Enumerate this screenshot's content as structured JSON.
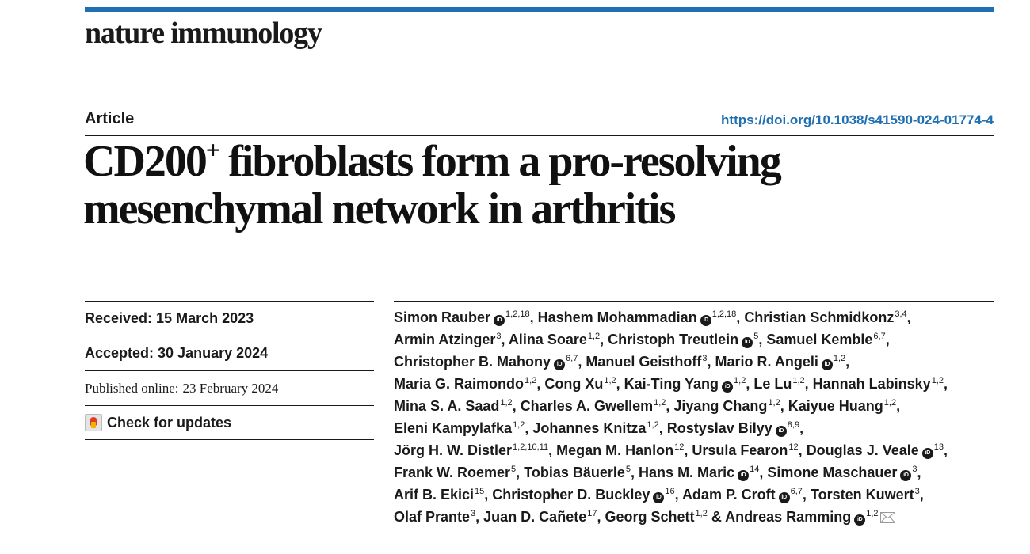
{
  "journal": "nature immunology",
  "article_type": "Article",
  "doi": "https://doi.org/10.1038/s41590-024-01774-4",
  "title": {
    "part1": "CD200",
    "sup": "+",
    "part2": " fibroblasts form a pro-resolving mesenchymal network in arthritis"
  },
  "meta": {
    "received_label": "Received:",
    "received": "15 March 2023",
    "accepted_label": "Accepted:",
    "accepted": "30 January 2024",
    "published_label": "Published online:",
    "published": "23 February 2024",
    "check_updates": "Check for updates"
  },
  "orcid_text": "iD",
  "authors": [
    {
      "name": "Simon Rauber",
      "orcid": true,
      "aff": "1,2,18"
    },
    {
      "name": "Hashem Mohammadian",
      "orcid": true,
      "aff": "1,2,18"
    },
    {
      "name": "Christian Schmidkonz",
      "orcid": false,
      "aff": "3,4"
    },
    {
      "name": "Armin Atzinger",
      "orcid": false,
      "aff": "3"
    },
    {
      "name": "Alina Soare",
      "orcid": false,
      "aff": "1,2"
    },
    {
      "name": "Christoph Treutlein",
      "orcid": true,
      "aff": "5"
    },
    {
      "name": "Samuel Kemble",
      "orcid": false,
      "aff": "6,7"
    },
    {
      "name": "Christopher B. Mahony",
      "orcid": true,
      "aff": "6,7"
    },
    {
      "name": "Manuel Geisthoff",
      "orcid": false,
      "aff": "3"
    },
    {
      "name": "Mario R. Angeli",
      "orcid": true,
      "aff": "1,2"
    },
    {
      "name": "Maria G. Raimondo",
      "orcid": false,
      "aff": "1,2"
    },
    {
      "name": "Cong Xu",
      "orcid": false,
      "aff": "1,2"
    },
    {
      "name": "Kai-Ting Yang",
      "orcid": true,
      "aff": "1,2"
    },
    {
      "name": "Le Lu",
      "orcid": false,
      "aff": "1,2"
    },
    {
      "name": "Hannah Labinsky",
      "orcid": false,
      "aff": "1,2"
    },
    {
      "name": "Mina S. A. Saad",
      "orcid": false,
      "aff": "1,2"
    },
    {
      "name": "Charles A. Gwellem",
      "orcid": false,
      "aff": "1,2"
    },
    {
      "name": "Jiyang Chang",
      "orcid": false,
      "aff": "1,2"
    },
    {
      "name": "Kaiyue Huang",
      "orcid": false,
      "aff": "1,2"
    },
    {
      "name": "Eleni Kampylafka",
      "orcid": false,
      "aff": "1,2"
    },
    {
      "name": "Johannes Knitza",
      "orcid": false,
      "aff": "1,2"
    },
    {
      "name": "Rostyslav Bilyy",
      "orcid": true,
      "aff": "8,9"
    },
    {
      "name": "Jörg H. W. Distler",
      "orcid": false,
      "aff": "1,2,10,11"
    },
    {
      "name": "Megan M. Hanlon",
      "orcid": false,
      "aff": "12"
    },
    {
      "name": "Ursula Fearon",
      "orcid": false,
      "aff": "12"
    },
    {
      "name": "Douglas J. Veale",
      "orcid": true,
      "aff": "13"
    },
    {
      "name": "Frank W. Roemer",
      "orcid": false,
      "aff": "5"
    },
    {
      "name": "Tobias Bäuerle",
      "orcid": false,
      "aff": "5"
    },
    {
      "name": "Hans M. Maric",
      "orcid": true,
      "aff": "14"
    },
    {
      "name": "Simone Maschauer",
      "orcid": true,
      "aff": "3"
    },
    {
      "name": "Arif B. Ekici",
      "orcid": false,
      "aff": "15"
    },
    {
      "name": "Christopher D. Buckley",
      "orcid": true,
      "aff": "16"
    },
    {
      "name": "Adam P. Croft",
      "orcid": true,
      "aff": "6,7"
    },
    {
      "name": "Torsten Kuwert",
      "orcid": false,
      "aff": "3"
    },
    {
      "name": "Olaf Prante",
      "orcid": false,
      "aff": "3"
    },
    {
      "name": "Juan D. Cañete",
      "orcid": false,
      "aff": "17"
    },
    {
      "name": "Georg Schett",
      "orcid": false,
      "aff": "1,2"
    },
    {
      "name": "Andreas Ramming",
      "orcid": true,
      "aff": "1,2",
      "corresponding": true
    }
  ],
  "line_breaks_after": [
    2,
    6,
    9,
    14,
    18,
    21,
    25,
    29,
    33
  ]
}
